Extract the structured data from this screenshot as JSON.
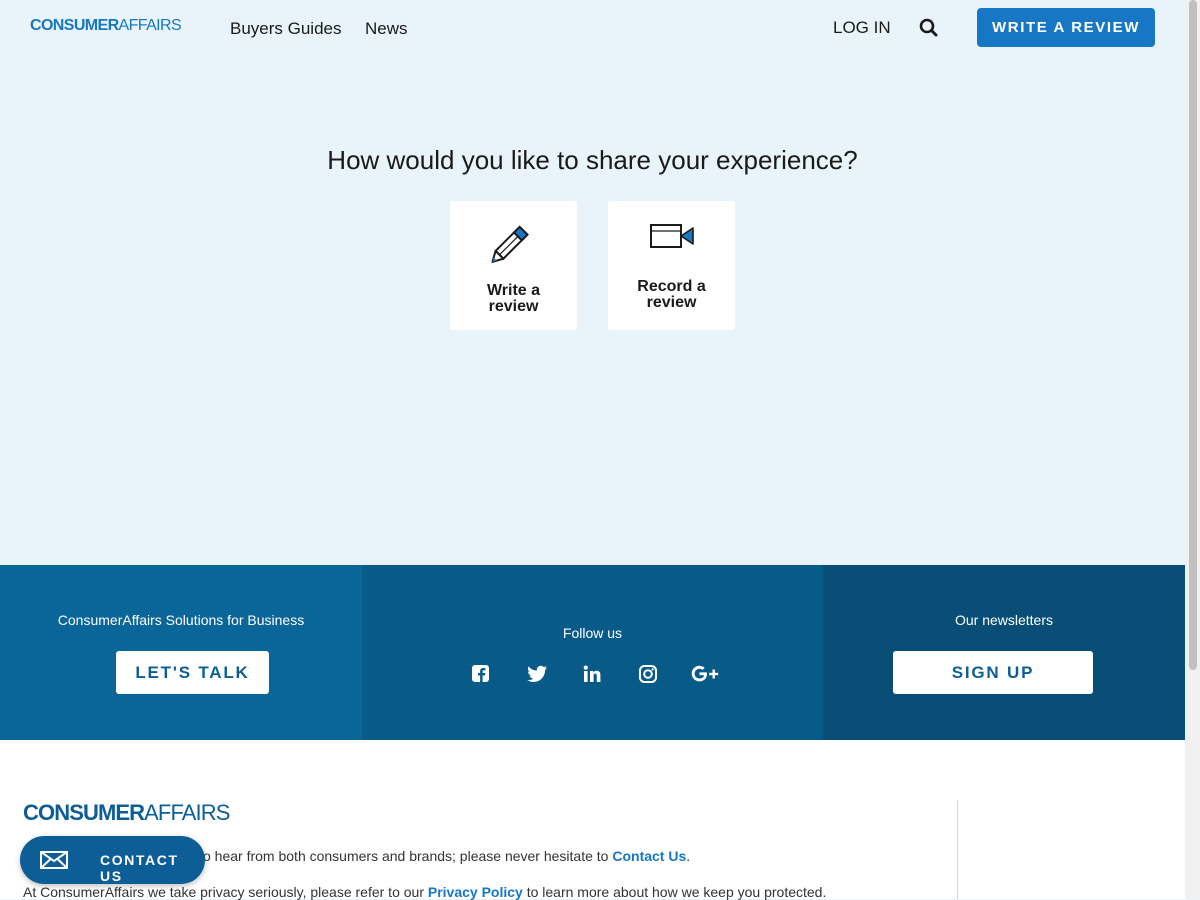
{
  "header": {
    "logo_bold": "CONSUMER",
    "logo_light": "AFFAIRS",
    "nav": [
      {
        "label": "Buyers Guides"
      },
      {
        "label": "News"
      }
    ],
    "login_label": "LOG IN",
    "search_icon": "search-icon",
    "write_review_label": "WRITE A REVIEW"
  },
  "main": {
    "title": "How would you like to share your experience?",
    "options": [
      {
        "label_line1": "Write a",
        "label_line2": "review",
        "icon": "pencil-icon"
      },
      {
        "label_line1": "Record a",
        "label_line2": "review",
        "icon": "video-camera-icon"
      }
    ]
  },
  "footer_band": {
    "business": {
      "title": "ConsumerAffairs Solutions for Business",
      "button": "LET'S TALK"
    },
    "follow": {
      "title": "Follow us",
      "icons": [
        "facebook-icon",
        "twitter-icon",
        "linkedin-icon",
        "instagram-icon",
        "google-plus-icon"
      ]
    },
    "newsletter": {
      "title": "Our newsletters",
      "button": "SIGN UP"
    }
  },
  "bottom_footer": {
    "logo_bold": "CONSUMER",
    "logo_light": "AFFAIRS",
    "line1_text": "o hear from both consumers and brands; please never hesitate to ",
    "line1_link": "Contact Us",
    "line1_end": ".",
    "line2_text": "At ConsumerAffairs we take privacy seriously, please refer to our ",
    "line2_link": "Privacy Policy",
    "line2_end": " to learn more about how we keep you protected."
  },
  "contact_pill": {
    "label": "CONTACT US",
    "icon": "envelope-icon"
  },
  "colors": {
    "page_bg": "#e8f4fa",
    "brand_blue": "#1777c4",
    "band_left": "#0a6598",
    "band_mid": "#085a89",
    "band_right": "#084e77"
  }
}
